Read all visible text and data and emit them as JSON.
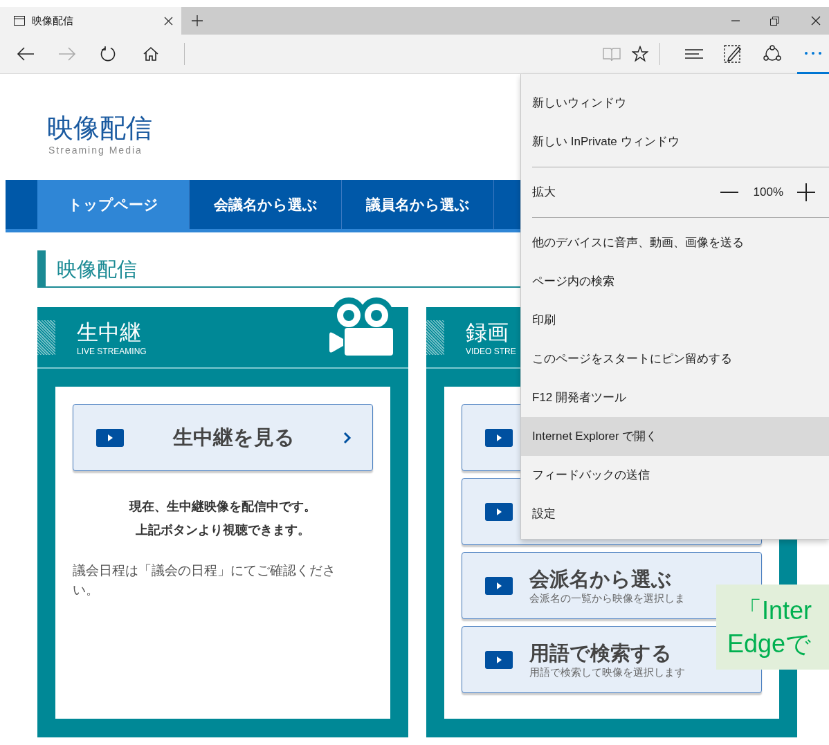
{
  "browser": {
    "tab": {
      "title": "映像配信"
    }
  },
  "page": {
    "logo": {
      "title": "映像配信",
      "subtitle": "Streaming Media"
    },
    "nav": [
      {
        "label": "トップページ",
        "selected": true
      },
      {
        "label": "会議名から選ぶ",
        "selected": false
      },
      {
        "label": "議員名から選ぶ",
        "selected": false
      }
    ],
    "heading": "映像配信",
    "cards": [
      {
        "title": "生中継",
        "subtitle": "LIVE STREAMING",
        "camera": true,
        "buttons": [
          {
            "kind": "single",
            "label": "生中継を見る"
          }
        ],
        "notice": [
          "現在、生中継映像を配信中です。",
          "上記ボタンより視聴できます。"
        ],
        "note": "議会日程は「議会の日程」にてご確認ください。"
      },
      {
        "title": "録画",
        "subtitle": "VIDEO STRE",
        "camera": false,
        "buttons": [
          {
            "kind": "covered"
          },
          {
            "kind": "covered"
          },
          {
            "kind": "stacked",
            "label": "会派名から選ぶ",
            "description": "会派名の一覧から映像を選択しま"
          },
          {
            "kind": "stacked",
            "label": "用語で検索する",
            "description": "用語で検索して映像を選択します"
          }
        ]
      }
    ]
  },
  "menu": {
    "items": [
      {
        "kind": "item",
        "label": "新しいウィンドウ",
        "selected": false
      },
      {
        "kind": "item",
        "label": "新しい InPrivate ウィンドウ",
        "selected": false
      },
      {
        "kind": "separator"
      },
      {
        "kind": "zoom",
        "label": "拡大",
        "value": "100%"
      },
      {
        "kind": "separator"
      },
      {
        "kind": "item",
        "label": "他のデバイスに音声、動画、画像を送る",
        "selected": false
      },
      {
        "kind": "item",
        "label": "ページ内の検索",
        "selected": false
      },
      {
        "kind": "item",
        "label": "印刷",
        "selected": false
      },
      {
        "kind": "item",
        "label": "このページをスタートにピン留めする",
        "selected": false
      },
      {
        "kind": "item",
        "label": "F12 開発者ツール",
        "selected": false
      },
      {
        "kind": "item",
        "label": "Internet Explorer で開く",
        "selected": true
      },
      {
        "kind": "item",
        "label": "フィードバックの送信",
        "selected": false
      },
      {
        "kind": "item",
        "label": "設定",
        "selected": false
      }
    ]
  },
  "callout": {
    "lines": [
      "「Inter",
      "Edgeで"
    ]
  }
}
